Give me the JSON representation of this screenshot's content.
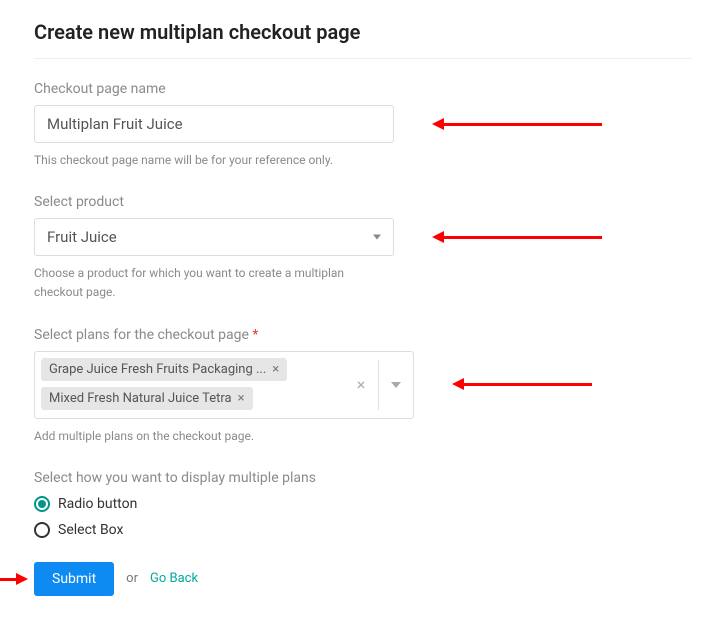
{
  "title": "Create new multiplan checkout page",
  "fields": {
    "pageName": {
      "label": "Checkout page name",
      "value": "Multiplan Fruit Juice",
      "helper": "This checkout page name will be for your reference only."
    },
    "product": {
      "label": "Select product",
      "value": "Fruit Juice",
      "helper": "Choose a product for which you want to create a multiplan checkout page."
    },
    "plans": {
      "label": "Select plans for the checkout page",
      "required": "*",
      "chips": [
        "Grape Juice Fresh Fruits Packaging ...",
        "Mixed Fresh Natural Juice Tetra"
      ],
      "helper": "Add multiple plans on the checkout page."
    },
    "display": {
      "label": "Select how you want to display multiple plans",
      "options": {
        "radio": "Radio button",
        "selectbox": "Select Box"
      }
    }
  },
  "footer": {
    "submit": "Submit",
    "or": "or",
    "goback": "Go Back"
  }
}
